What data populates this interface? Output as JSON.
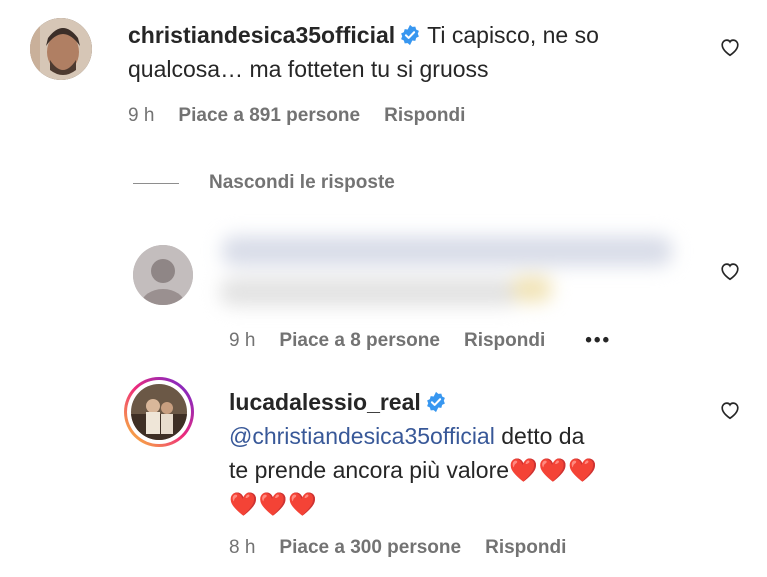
{
  "comments": [
    {
      "username": "christiandesica35official",
      "text": "Ti capisco, ne so qualcosa… ma fotteten tu si gruoss",
      "line1": "Ti capisco, ne so",
      "line2": "qualcosa… ma fotteten tu si gruoss",
      "time": "9 h",
      "likes": "Piace a 891 persone",
      "reply": "Rispondi"
    },
    {
      "time": "9 h",
      "likes": "Piace a 8 persone",
      "reply": "Rispondi",
      "more": "•••"
    },
    {
      "username": "lucadalessio_real",
      "mention": "@christiandesica35official",
      "line1_rest": " detto da",
      "line2": "te prende ancora più valore",
      "line2_hearts": "❤️❤️❤️",
      "line3": "❤️❤️❤️",
      "time": "8 h",
      "likes": "Piace a 300 persone",
      "reply": "Rispondi"
    }
  ],
  "replies_toggle": "Nascondi le risposte",
  "colors": {
    "verified": "#3897f0",
    "heart": "#e0201f",
    "mention": "#385898",
    "meta": "#737373"
  },
  "icons": [
    "verified-badge-icon",
    "heart-outline-icon",
    "more-options-icon"
  ]
}
